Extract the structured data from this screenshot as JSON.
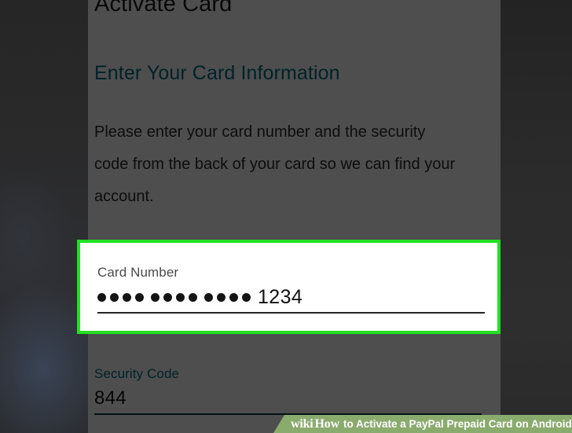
{
  "app": {
    "page_title": "Activate Card",
    "section_heading": "Enter Your Card Information",
    "instructions": "Please enter your card number and the security code from the back of your card so we can find your account."
  },
  "form": {
    "card_number": {
      "label": "Card Number",
      "masked_groups": 3,
      "masked_digits_per_group": 4,
      "visible_digits": "1234",
      "display_value": "•••• •••• •••• 1234"
    },
    "security_code": {
      "label": "Security Code",
      "value": "844"
    }
  },
  "highlight": {
    "color": "#22e022",
    "target": "card-number-field"
  },
  "colors": {
    "accent_teal": "#00707f",
    "underline_dark": "#0c3a47",
    "panel_background": "#ffffff",
    "backdrop": "#2b2b2b",
    "watermark_green": "#8aab6e"
  },
  "watermark": {
    "brand_wiki": "wiki",
    "brand_how": "How",
    "tail": "to Activate a PayPal Prepaid Card on Android"
  }
}
